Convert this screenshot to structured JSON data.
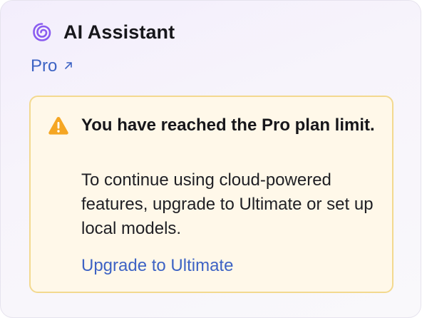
{
  "header": {
    "title": "AI Assistant",
    "logo_icon": "ai-assistant-spiral-icon"
  },
  "plan": {
    "label": "Pro",
    "external_icon": "arrow-up-right-icon"
  },
  "warning": {
    "icon": "warning-triangle-icon",
    "title": "You have reached the Pro plan limit.",
    "body": "To continue using cloud-powered features, upgrade to Ultimate or set up local models.",
    "action_label": "Upgrade to Ultimate"
  },
  "colors": {
    "accent_purple": "#8a5cf0",
    "link_blue": "#3d63c4",
    "warning_orange": "#f5a623",
    "warning_bg": "#fff8e9",
    "warning_border": "#f3d98f"
  }
}
